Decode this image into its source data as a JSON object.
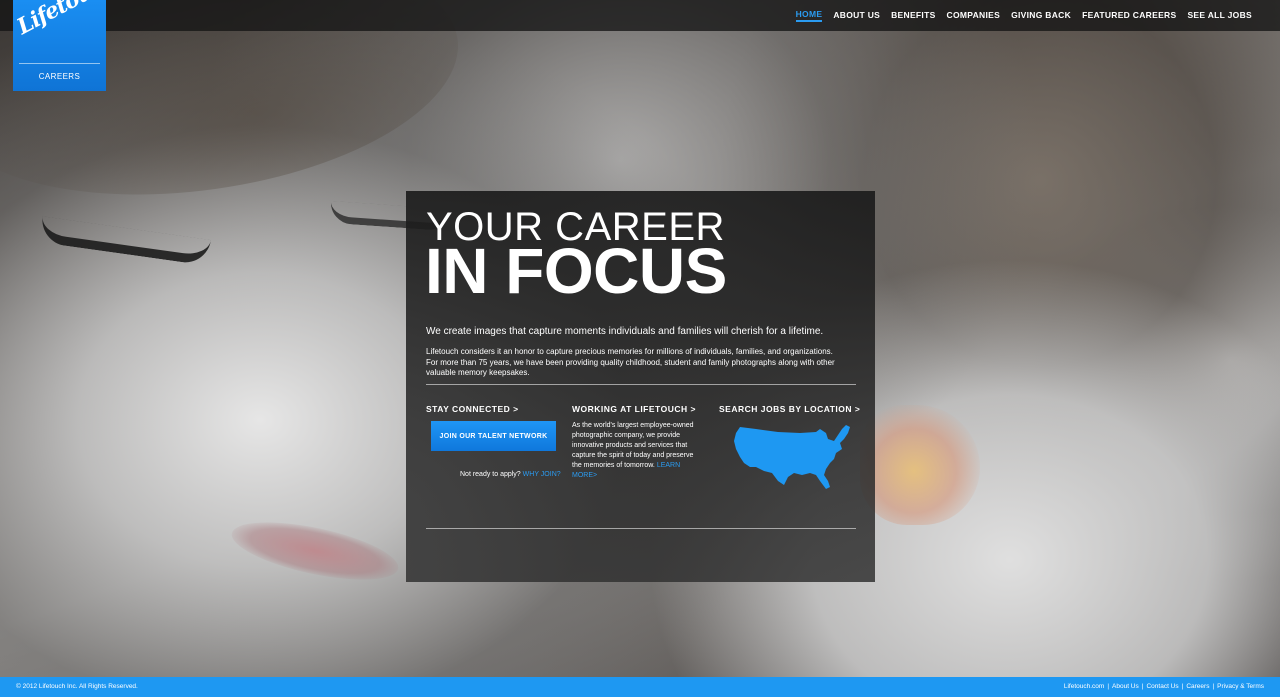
{
  "brand": {
    "logo_text": "Lifetouch",
    "sub_label": "CAREERS",
    "accent_color": "#1e98f2"
  },
  "nav": {
    "items": [
      {
        "label": "HOME",
        "active": true
      },
      {
        "label": "ABOUT US",
        "active": false
      },
      {
        "label": "BENEFITS",
        "active": false
      },
      {
        "label": "COMPANIES",
        "active": false
      },
      {
        "label": "GIVING BACK",
        "active": false
      },
      {
        "label": "FEATURED CAREERS",
        "active": false
      },
      {
        "label": "SEE ALL JOBS",
        "active": false
      }
    ]
  },
  "hero": {
    "headline_line1": "YOUR CAREER",
    "headline_line2": "IN FOCUS",
    "lead": "We create images that capture moments individuals and families will cherish for a lifetime.",
    "body": "Lifetouch considers it an honor to capture precious memories for millions of individuals, families, and organizations. For more than 75 years, we have been providing quality childhood, student and family photographs along with other valuable memory keepsakes."
  },
  "columns": {
    "stay_connected": {
      "heading": "STAY CONNECTED >",
      "button_label": "JOIN OUR TALENT NETWORK",
      "ready_text": "Not ready to apply?",
      "why_join_link": "WHY JOIN?"
    },
    "working": {
      "heading": "WORKING AT LIFETOUCH >",
      "text": "As the world's largest employee-owned photographic company, we provide innovative products and services that capture the spirit of today and preserve the memories of tomorrow.",
      "learn_more_link": "LEARN MORE>"
    },
    "search": {
      "heading": "SEARCH JOBS BY LOCATION >",
      "map_icon": "us-map-icon"
    }
  },
  "footer": {
    "copyright": "© 2012 Lifetouch Inc. All Rights Reserved.",
    "links": [
      "Lifetouch.com",
      "About Us",
      "Contact Us",
      "Careers",
      "Privacy & Terms"
    ]
  }
}
